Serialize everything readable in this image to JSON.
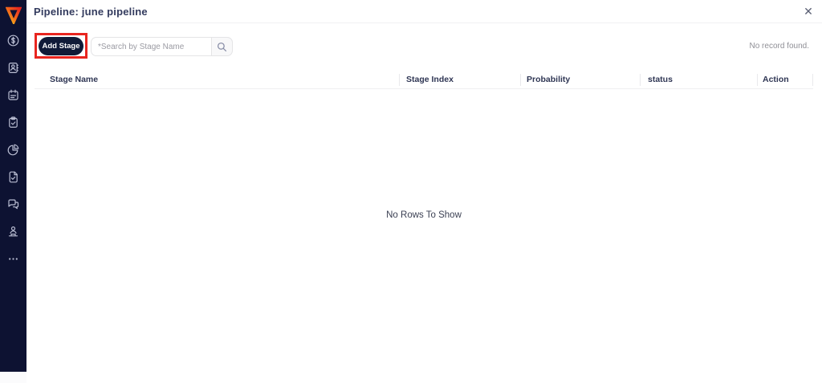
{
  "window": {
    "title": "Pipeline: june pipeline",
    "close_glyph": "✕"
  },
  "sidebar": {
    "logo": "v-triangle-logo",
    "items": [
      {
        "icon": "dollar-circle-icon"
      },
      {
        "icon": "contact-book-icon"
      },
      {
        "icon": "calendar-icon"
      },
      {
        "icon": "clipboard-check-icon"
      },
      {
        "icon": "pie-chart-icon"
      },
      {
        "icon": "file-check-icon"
      },
      {
        "icon": "chat-bubbles-icon"
      },
      {
        "icon": "person-desk-icon"
      },
      {
        "icon": "ellipsis-icon"
      }
    ]
  },
  "toolbar": {
    "add_stage_label": "Add Stage",
    "search_placeholder": "*Search by Stage Name",
    "search_icon": "magnifier-icon",
    "no_record_text": "No record found."
  },
  "table": {
    "columns": [
      "Stage Name",
      "Stage Index",
      "Probability",
      "status",
      "Action"
    ],
    "rows": [],
    "empty_text": "No Rows To Show"
  },
  "colors": {
    "sidebar_bg": "#0d1232",
    "button_navy": "#101b38",
    "annotation_red": "#e8251f",
    "title_text": "#333b5e",
    "muted_text": "#8f8f96",
    "logo_gradient": [
      "#e8251f",
      "#f46a1b",
      "#f7c21a"
    ]
  }
}
